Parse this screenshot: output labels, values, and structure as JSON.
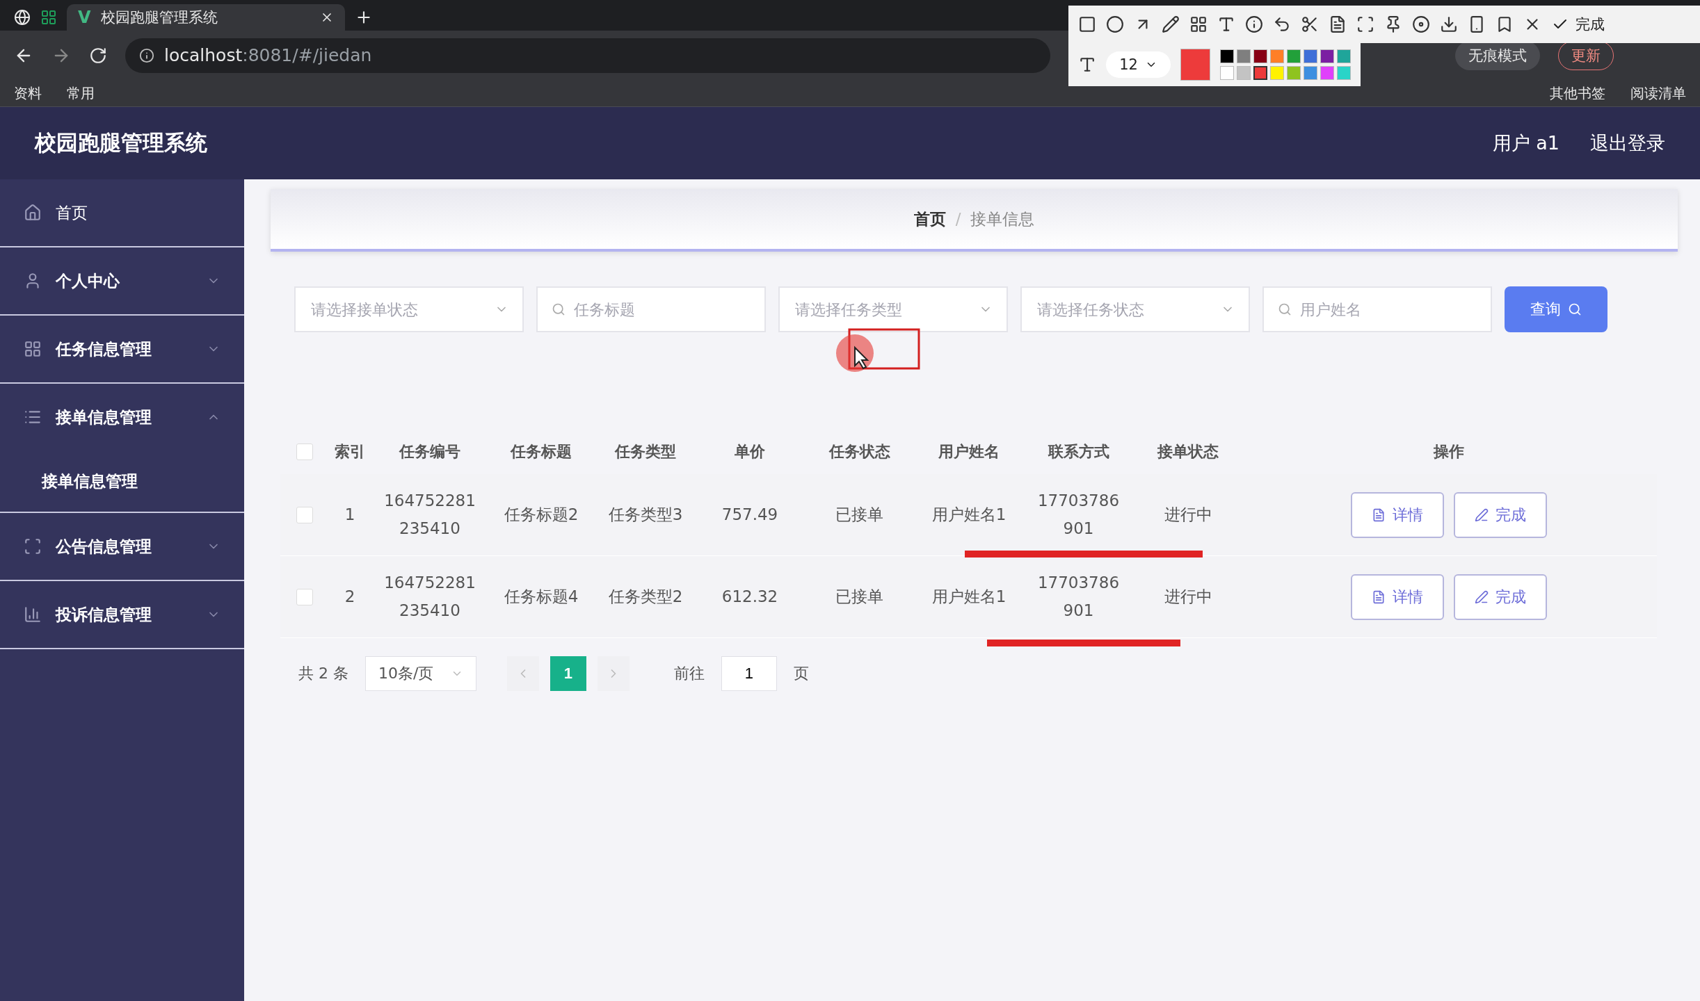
{
  "browser": {
    "tab_logo": "V",
    "tab_title": "校园跑腿管理系统",
    "url_host": "localhost",
    "url_path": ":8081/#/jiedan",
    "bookmarks": [
      "资料",
      "常用"
    ],
    "incognito": "无痕模式",
    "update": "更新",
    "other_bookmarks": "其他书签",
    "reading_list": "阅读清单"
  },
  "capture_toolbar": {
    "font_size": "12",
    "done": "完成",
    "palette": [
      {
        "color": "#000000",
        "selected": false
      },
      {
        "color": "#7f7f7f",
        "selected": false
      },
      {
        "color": "#880015",
        "selected": false
      },
      {
        "color": "#ff7f27",
        "selected": false
      },
      {
        "color": "#22a03a",
        "selected": false
      },
      {
        "color": "#3f6fd8",
        "selected": false
      },
      {
        "color": "#7b1fa2",
        "selected": false
      },
      {
        "color": "#1fa59a",
        "selected": false
      },
      {
        "color": "#ffffff",
        "selected": false
      },
      {
        "color": "#c3c3c3",
        "selected": false
      },
      {
        "color": "#ed3b3b",
        "selected": true
      },
      {
        "color": "#fff200",
        "selected": false
      },
      {
        "color": "#8fc31f",
        "selected": false
      },
      {
        "color": "#3d8fe0",
        "selected": false
      },
      {
        "color": "#e040fb",
        "selected": false
      },
      {
        "color": "#2ad4c8",
        "selected": false
      }
    ]
  },
  "header": {
    "title": "校园跑腿管理系统",
    "user": "用户 a1",
    "logout": "退出登录"
  },
  "sidebar": {
    "items": [
      {
        "kind": "link",
        "label": "首页"
      },
      {
        "kind": "group",
        "label": "个人中心",
        "expanded": false
      },
      {
        "kind": "group",
        "label": "任务信息管理",
        "expanded": false
      },
      {
        "kind": "group",
        "label": "接单信息管理",
        "expanded": true,
        "children": [
          {
            "label": "接单信息管理",
            "selected": true
          }
        ]
      },
      {
        "kind": "group",
        "label": "公告信息管理",
        "expanded": false
      },
      {
        "kind": "group",
        "label": "投诉信息管理",
        "expanded": false
      }
    ]
  },
  "breadcrumb": {
    "items": [
      "首页",
      "接单信息"
    ],
    "separator": "/"
  },
  "filters": [
    {
      "kind": "select",
      "placeholder": "请选择接单状态"
    },
    {
      "kind": "input",
      "placeholder": "任务标题"
    },
    {
      "kind": "select",
      "placeholder": "请选择任务类型"
    },
    {
      "kind": "select",
      "placeholder": "请选择任务状态"
    },
    {
      "kind": "input",
      "placeholder": "用户姓名"
    }
  ],
  "search_button": "查询",
  "table": {
    "select_all_checked": false,
    "columns": [
      "索引",
      "任务编号",
      "任务标题",
      "任务类型",
      "单价",
      "任务状态",
      "用户姓名",
      "联系方式",
      "接单状态",
      "操作"
    ],
    "rows": [
      {
        "checked": false,
        "cells": [
          "1",
          "164752281\n235410",
          "任务标题2",
          "任务类型3",
          "757.49",
          "已接单",
          "用户姓名1",
          "17703786\n901",
          "进行中"
        ],
        "actions": [
          "详情",
          "完成"
        ]
      },
      {
        "checked": false,
        "cells": [
          "2",
          "164752281\n235410",
          "任务标题4",
          "任务类型2",
          "612.32",
          "已接单",
          "用户姓名1",
          "17703786\n901",
          "进行中"
        ],
        "actions": [
          "详情",
          "完成"
        ]
      }
    ]
  },
  "pagination": {
    "total": "共 2 条",
    "page_size": "10条/页",
    "pages": [
      {
        "label": "1",
        "selected": true
      }
    ],
    "goto": "前往",
    "goto_value": "1",
    "goto_suffix": "页"
  }
}
